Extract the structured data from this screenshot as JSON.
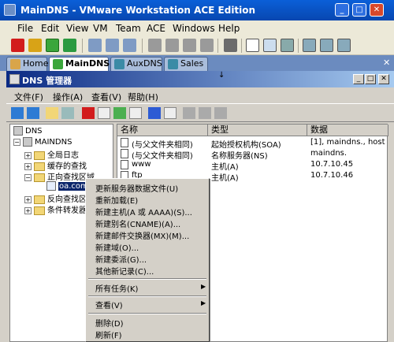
{
  "vmware": {
    "title": "MainDNS - VMware Workstation ACE Edition",
    "window_controls": [
      "_",
      "□",
      "✕"
    ],
    "menu": [
      "File",
      "Edit",
      "View",
      "VM",
      "Team",
      "ACE",
      "Windows",
      "Help"
    ],
    "tabs": [
      {
        "label": "Home",
        "active": false
      },
      {
        "label": "MainDNS",
        "active": true
      },
      {
        "label": "AuxDNS",
        "active": false
      },
      {
        "label": "Sales",
        "active": false
      }
    ],
    "tab_close": "✕"
  },
  "guest": {
    "title": "DNS 管理器",
    "window_controls": [
      "_",
      "□",
      "✕"
    ],
    "menu": [
      "文件(F)",
      "操作(A)",
      "查看(V)",
      "帮助(H)"
    ],
    "tree": [
      {
        "label": "DNS",
        "level": 0,
        "expander": ""
      },
      {
        "label": "MAINDNS",
        "level": 1,
        "expander": "−"
      },
      {
        "label": "全局日志",
        "level": 2,
        "expander": "+"
      },
      {
        "label": "缓存的查找",
        "level": 2,
        "expander": "+"
      },
      {
        "label": "正向查找区域",
        "level": 2,
        "expander": "−"
      },
      {
        "label": "oa.com",
        "level": 3,
        "expander": ""
      },
      {
        "label": "反向查找区域",
        "level": 2,
        "expander": "+"
      },
      {
        "label": "条件转发器",
        "level": 2,
        "expander": "+"
      }
    ],
    "columns": [
      "名称",
      "类型",
      "数据"
    ],
    "rows": [
      {
        "name": "(与父文件夹相同)",
        "type": "起始授权机构(SOA)",
        "data": "[1], maindns., host"
      },
      {
        "name": "(与父文件夹相同)",
        "type": "名称服务器(NS)",
        "data": "maindns."
      },
      {
        "name": "www",
        "type": "主机(A)",
        "data": "10.7.10.45"
      },
      {
        "name": "ftp",
        "type": "主机(A)",
        "data": "10.7.10.46"
      }
    ]
  },
  "context_menu": {
    "group1": [
      "更新服务器数据文件(U)",
      "重新加载(E)",
      "新建主机(A 或 AAAA)(S)...",
      "新建别名(CNAME)(A)...",
      "新建邮件交换器(MX)(M)...",
      "新建域(O)...",
      "新建委派(G)...",
      "其他新记录(C)..."
    ],
    "group2": [
      "所有任务(K)"
    ],
    "group3": [
      "查看(V)"
    ],
    "group4": [
      "删除(D)",
      "刷新(F)"
    ],
    "submenu_arrow": "▶"
  },
  "colors": {
    "vm_title": "#0a5fd8",
    "guest_title": "#0b2a84",
    "selection": "#0a246a"
  }
}
